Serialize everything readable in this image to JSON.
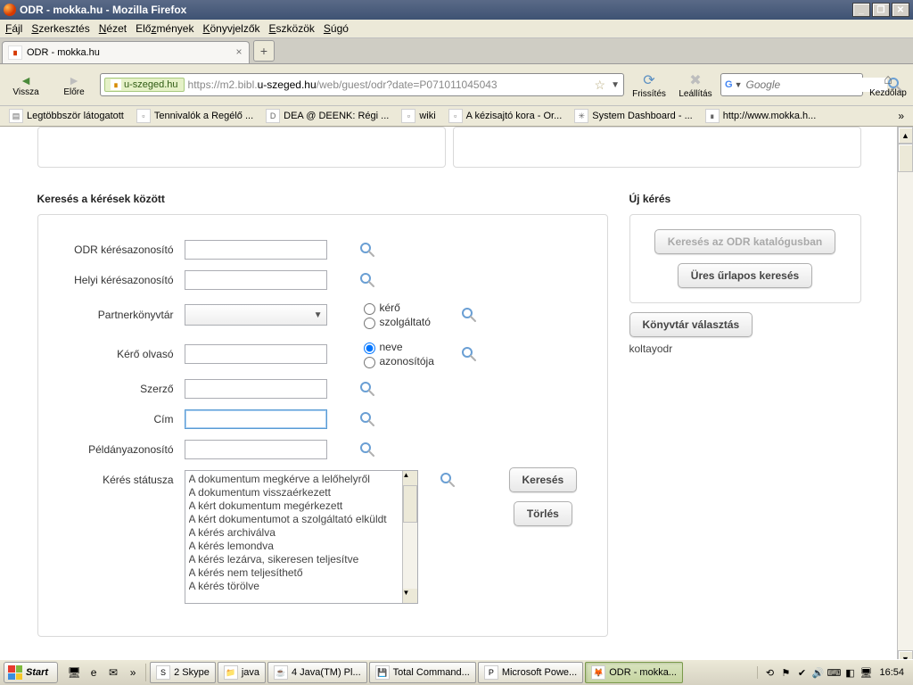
{
  "window": {
    "title": "ODR - mokka.hu - Mozilla Firefox",
    "min": "_",
    "max": "□",
    "close": "×",
    "restore": "❐"
  },
  "menus": [
    "Fájl",
    "Szerkesztés",
    "Nézet",
    "Előzmények",
    "Könyvjelzők",
    "Eszközök",
    "Súgó"
  ],
  "tab": {
    "label": "ODR - mokka.hu"
  },
  "nav": {
    "back": "Vissza",
    "forward": "Előre",
    "identity": "u-szeged.hu",
    "url_pre": "https://m2.bibl.",
    "url_bold": "u-szeged.hu",
    "url_post": "/web/guest/odr?date=P071011045043",
    "refresh": "Frissítés",
    "stop": "Leállítás",
    "search_placeholder": "Google",
    "home": "Kezdőlap"
  },
  "bookmarks": [
    "Legtöbbször látogatott",
    "Tennivalók a Regélő ...",
    "DEA @ DEENK: Régi ...",
    "wiki",
    "A kézisajtó kora - Or...",
    "System Dashboard - ...",
    "http://www.mokka.h..."
  ],
  "left": {
    "title": "Keresés a kérések között",
    "labels": {
      "odr_id": "ODR kérésazonosító",
      "local_id": "Helyi kérésazonosító",
      "partner": "Partnerkönyvtár",
      "reader": "Kérő olvasó",
      "author": "Szerző",
      "title": "Cím",
      "item_id": "Példányazonosító",
      "status": "Kérés státusza"
    },
    "radios": {
      "partner_a": "kérő",
      "partner_b": "szolgáltató",
      "reader_a": "neve",
      "reader_b": "azonosítója"
    },
    "status_options": [
      "A dokumentum megkérve a lelőhelyről",
      "A dokumentum visszaérkezett",
      "A kért dokumentum megérkezett",
      "A kért dokumentumot a szolgáltató elküldt",
      "A kérés archiválva",
      "A kérés lemondva",
      "A kérés lezárva, sikeresen teljesítve",
      "A kérés nem teljesíthető",
      "A kérés törölve"
    ],
    "search_btn": "Keresés",
    "clear_btn": "Törlés"
  },
  "right": {
    "title": "Új kérés",
    "btn_catalog": "Keresés az ODR katalógusban",
    "btn_blank": "Üres űrlapos keresés",
    "btn_choose": "Könyvtár választás",
    "user": "koltayodr"
  },
  "taskbar": {
    "start": "Start",
    "tasks": [
      {
        "icon": "S",
        "label": "2 Skype",
        "cls": ""
      },
      {
        "icon": "📁",
        "label": "java",
        "cls": ""
      },
      {
        "icon": "☕",
        "label": "4 Java(TM) Pl...",
        "cls": ""
      },
      {
        "icon": "💾",
        "label": "Total Command...",
        "cls": ""
      },
      {
        "icon": "P",
        "label": "Microsoft Powe...",
        "cls": ""
      },
      {
        "icon": "🦊",
        "label": "ODR - mokka...",
        "cls": "active"
      }
    ],
    "clock": "16:54"
  }
}
